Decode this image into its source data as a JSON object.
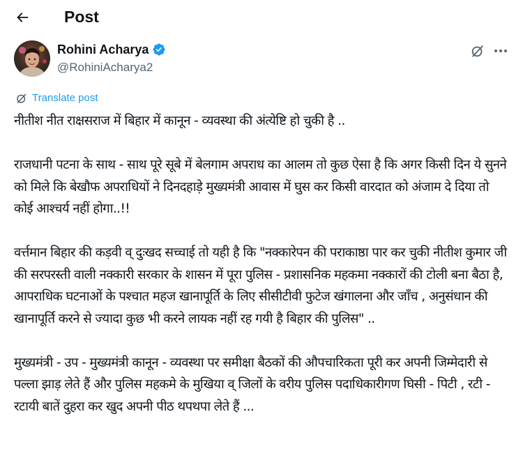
{
  "header": {
    "title": "Post",
    "back_icon": "arrow-left-icon"
  },
  "author": {
    "name": "Rohini Acharya",
    "handle": "@RohiniAcharya2",
    "verified_icon": "verified-badge-icon",
    "verified_color": "#1d9bf0"
  },
  "actions": {
    "grok_icon": "grok-icon",
    "more_icon": "more-horizontal-icon"
  },
  "translate": {
    "label": "Translate post",
    "icon": "translate-icon",
    "color": "#1d9bf0"
  },
  "post": {
    "paragraphs": [
      "नीतीश नीत राक्षसराज में बिहार में कानून - व्यवस्था की अंत्येष्टि हो चुकी है ..",
      "राजधानी पटना के साथ - साथ पूरे सूबे में बेलगाम अपराध का आलम तो कुछ ऐसा है कि अगर किसी दिन ये सुनने को मिले कि बेखौफ अपराधियों ने दिनदहाड़े मुख्यमंत्री आवास में घुस कर किसी वारदात को अंजाम दे दिया तो कोई आश्चर्य नहीं होगा..!!",
      "वर्त्तमान बिहार की कड़वी व् दुःखद सच्चाई तो यही है कि \"नक्कारेपन की पराकाष्ठा पार कर चुकी नीतीश कुमार जी की सरपरस्ती वाली नक्कारी सरकार के शासन में पूरा पुलिस - प्रशासनिक महकमा नक्कारों की टोली बना बैठा है, आपराधिक घटनाओं के पश्चात महज खानापूर्ति के लिए सीसीटीवी फुटेज खंगालना और जाँच , अनुसंधान की खानापूर्ति करने से ज्यादा कुछ भी करने लायक नहीं रह गयी है बिहार की पुलिस\" ..",
      "मुख्यमंत्री - उप - मुख्यमंत्री कानून - व्यवस्था पर समीक्षा बैठकों की औपचारिकता पूरी कर अपनी  जिम्मेदारी से पल्ला झाड़ लेते हैं और पुलिस महकमे के मुखिया व् जिलों के वरीय पुलिस पदाधिकारीगण घिसी - पिटी , रटी - रटायी बातें दुहरा कर खुद अपनी पीठ थपथपा लेते हैं ..."
    ]
  }
}
